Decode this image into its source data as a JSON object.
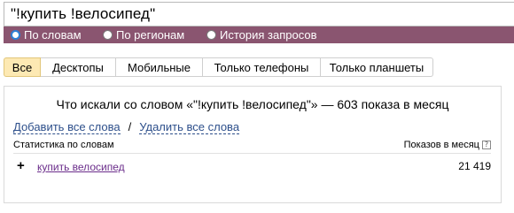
{
  "search": {
    "query": "\"!купить !велосипед\""
  },
  "modes": [
    {
      "label": "По словам",
      "checked": true
    },
    {
      "label": "По регионам",
      "checked": false
    },
    {
      "label": "История запросов",
      "checked": false
    }
  ],
  "tabs": [
    {
      "label": "Все",
      "active": true
    },
    {
      "label": "Десктопы",
      "active": false
    },
    {
      "label": "Мобильные",
      "active": false
    },
    {
      "label": "Только телефоны",
      "active": false
    },
    {
      "label": "Только планшеты",
      "active": false
    }
  ],
  "panel": {
    "summary": "Что искали со словом «\"!купить !велосипед\"» — 603 показа в месяц",
    "add_all": "Добавить все слова",
    "separator": "/",
    "remove_all": "Удалить все слова",
    "col_words": "Статистика по словам",
    "col_shows": "Показов в месяц",
    "help_glyph": "?",
    "rows": [
      {
        "plus": "+",
        "word": "купить велосипед",
        "count": "21 419"
      }
    ]
  },
  "colors": {
    "mode_bar": "#8a5570",
    "tab_active": "#fde9b3",
    "link": "#2d4f8b",
    "visited_link": "#6a2c8a",
    "radio_accent": "#2d7fd6"
  }
}
